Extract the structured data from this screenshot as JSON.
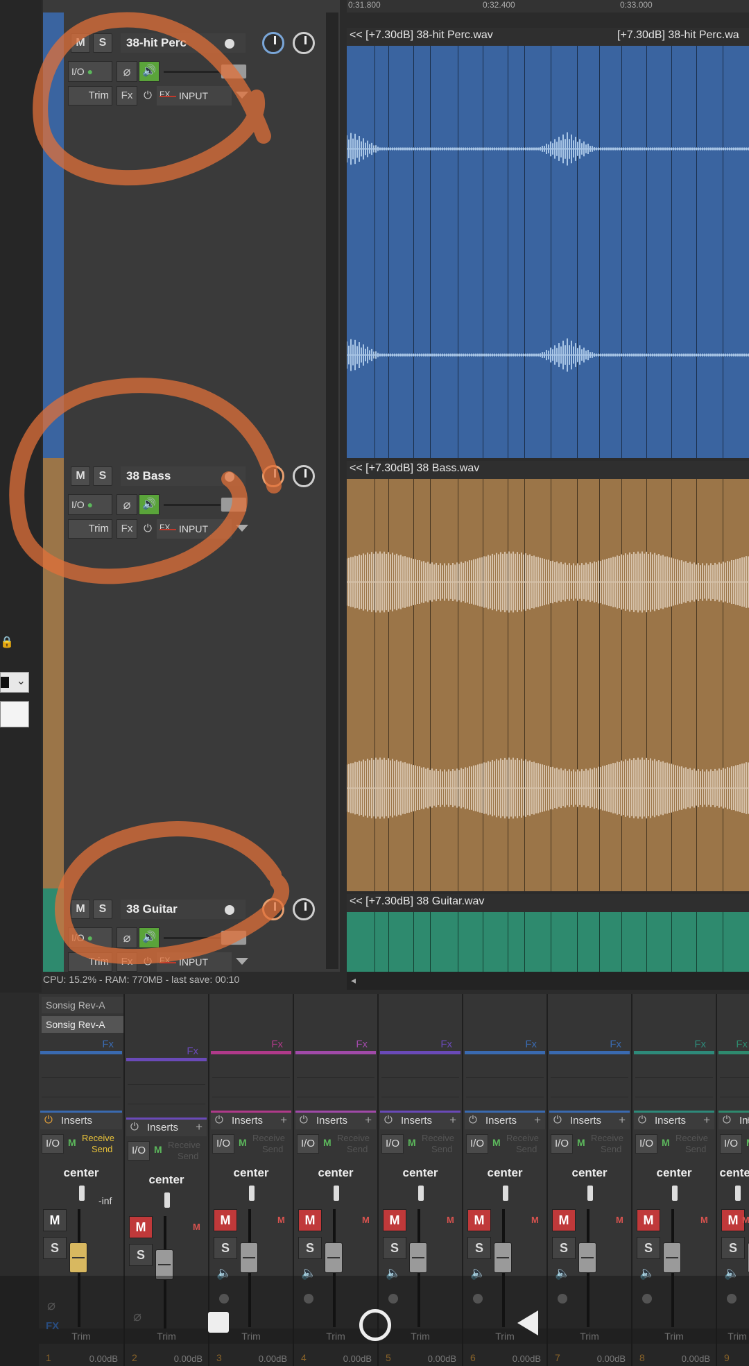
{
  "ruler": {
    "labels": [
      "0:31.800",
      "0:32.400",
      "0:33.000"
    ]
  },
  "tracks": [
    {
      "name": "38-hit Perc",
      "item_label_1": "<< [+7.30dB] 38-hit Perc.wav",
      "item_label_2": "[+7.30dB] 38-hit Perc.wa",
      "color": "#3a64a0",
      "stripe": "#3a64a0"
    },
    {
      "name": "38 Bass",
      "item_label_1": "<< [+7.30dB] 38 Bass.wav",
      "color": "#9b7548",
      "stripe": "#9b7548"
    },
    {
      "name": "38 Guitar",
      "item_label_1": "<< [+7.30dB] 38 Guitar.wav",
      "color": "#2e8a6e",
      "stripe": "#2e8a6e"
    }
  ],
  "tcp": {
    "mute": "M",
    "solo": "S",
    "io": "I/O",
    "trim": "Trim",
    "fx": "Fx",
    "fx_small": "FX",
    "input": "INPUT"
  },
  "status": {
    "cpu": "CPU: 15.2% - RAM: 770MB - last save: 00:10"
  },
  "mixer": {
    "sends": [
      "Sonsig Rev-A",
      "Sonsig Rev-A"
    ],
    "inserts": "Inserts",
    "io": "I/O",
    "m": "M",
    "receive": "Receive",
    "send": "Send",
    "pan": "center",
    "solo": "S",
    "mute": "M",
    "inf": "-inf",
    "fx_label": "FX",
    "fx": "Fx",
    "trim": "Trim",
    "channels": [
      {
        "num": "1",
        "db": "0.00dB",
        "color": "#3a6ab0"
      },
      {
        "num": "2",
        "db": "0.00dB",
        "color": "#6a4ab8"
      },
      {
        "num": "3",
        "db": "0.00dB",
        "color": "#b03a8a"
      },
      {
        "num": "4",
        "db": "0.00dB",
        "color": "#a04aa8"
      },
      {
        "num": "5",
        "db": "0.00dB",
        "color": "#6a4ab8"
      },
      {
        "num": "6",
        "db": "0.00dB",
        "color": "#3a6ab0"
      },
      {
        "num": "7",
        "db": "0.00dB",
        "color": "#3a6ab0"
      },
      {
        "num": "8",
        "db": "0.00dB",
        "color": "#2e8a7a"
      },
      {
        "num": "9",
        "db": "",
        "color": "#2e8a6e"
      }
    ]
  },
  "colors": {
    "annotation": "#e0703a",
    "mute_active": "#c0393a",
    "fader_yellow": "#d8b860"
  }
}
